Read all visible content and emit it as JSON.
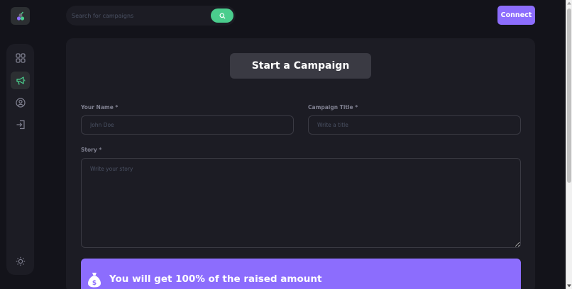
{
  "colors": {
    "background": "#13131a",
    "panel": "#1c1c24",
    "accent_green": "#4acd8d",
    "accent_purple": "#8c6dfd",
    "input_border": "#3a3a43",
    "label": "#808191"
  },
  "sidebar": {
    "logo_icon": "crowdfunding-logo-icon",
    "items": [
      {
        "icon": "dashboard-icon",
        "active": false
      },
      {
        "icon": "megaphone-icon",
        "active": true
      },
      {
        "icon": "profile-icon",
        "active": false
      },
      {
        "icon": "logout-icon",
        "active": false
      }
    ],
    "theme_icon": "sun-icon"
  },
  "search": {
    "placeholder": "Search for campaigns",
    "icon": "search-icon"
  },
  "header": {
    "connect_label": "Connect"
  },
  "form": {
    "title": "Start a Campaign",
    "name_label": "Your Name *",
    "name_placeholder": "John Doe",
    "campaign_title_label": "Campaign Title *",
    "campaign_title_placeholder": "Write a title",
    "story_label": "Story *",
    "story_placeholder": "Write your story",
    "banner_text": "You will get 100% of the raised amount",
    "banner_icon": "money-bag-icon"
  }
}
